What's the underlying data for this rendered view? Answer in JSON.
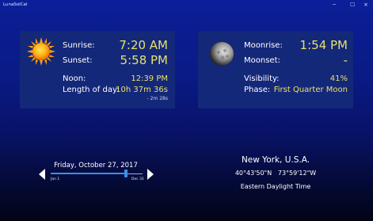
{
  "window": {
    "title": "LunaSolCal",
    "minimize_icon": "minimize-icon",
    "maximize_icon": "maximize-icon",
    "close_icon": "close-icon"
  },
  "sun_panel": {
    "icon": "sun-icon",
    "sunrise_label": "Sunrise:",
    "sunrise_value": "7:20 AM",
    "sunset_label": "Sunset:",
    "sunset_value": "5:58 PM",
    "noon_label": "Noon:",
    "noon_value": "12:39 PM",
    "length_label": "Length of day:",
    "length_value": "10h 37m 36s",
    "length_delta": "- 2m 28s"
  },
  "moon_panel": {
    "icon": "moon-icon",
    "moonrise_label": "Moonrise:",
    "moonrise_value": "1:54 PM",
    "moonset_label": "Moonset:",
    "moonset_value": "-",
    "visibility_label": "Visibility:",
    "visibility_value": "41%",
    "phase_label": "Phase:",
    "phase_value": "First Quarter Moon"
  },
  "date_nav": {
    "date": "Friday, October 27, 2017",
    "start_label": "Jan 1",
    "end_label": "Dec 31",
    "year_progress": 0.82,
    "prev_icon": "triangle-left-icon",
    "next_icon": "triangle-right-icon"
  },
  "location": {
    "city": "New York, U.S.A.",
    "latitude": "40°43'50\"N",
    "longitude": "73°59'12\"W",
    "timezone": "Eastern Daylight Time"
  },
  "colors": {
    "accent_value": "#e8e06a",
    "panel_bg": "#14287a",
    "slider": "#3d8ee4"
  }
}
